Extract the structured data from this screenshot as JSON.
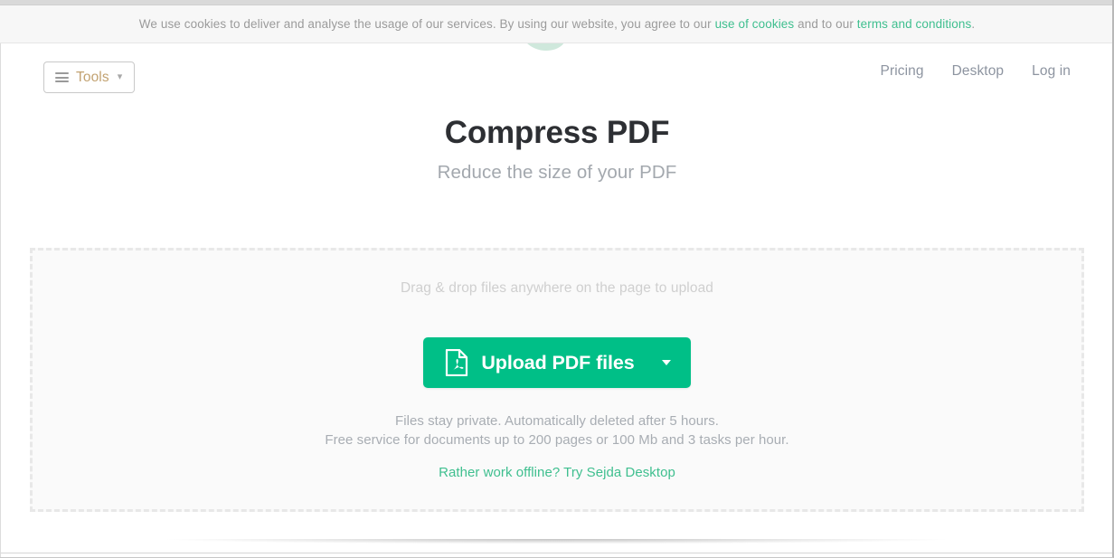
{
  "cookie_banner": {
    "text_before": "We use cookies to deliver and analyse the usage of our services. By using our website, you agree to our ",
    "link_cookies": "use of cookies",
    "text_middle": " and to our ",
    "link_terms": "terms and conditions",
    "text_after": "."
  },
  "header": {
    "tools_button": {
      "label": "Tools",
      "menu_icon": "hamburger-icon",
      "caret_icon": "chevron-down-icon"
    },
    "nav": [
      {
        "label": "Pricing"
      },
      {
        "label": "Desktop"
      },
      {
        "label": "Log in"
      }
    ]
  },
  "hero": {
    "title": "Compress PDF",
    "subtitle": "Reduce the size of your PDF"
  },
  "dropzone": {
    "drag_hint": "Drag & drop files anywhere on the page to upload",
    "upload_button": {
      "label": "Upload PDF files",
      "file_icon": "pdf-file-icon",
      "caret_icon": "caret-down-icon"
    },
    "notes": [
      "Files stay private. Automatically deleted after 5 hours.",
      "Free service for documents up to 200 pages or 100 Mb and 3 tasks per hour."
    ],
    "offline_link": "Rather work offline? Try Sejda Desktop"
  },
  "branding": {
    "watermark_icon": "sejda-s-logo",
    "accent_green": "#00bf87",
    "link_green": "#3fbf8f",
    "tools_gold": "#c2a271"
  }
}
